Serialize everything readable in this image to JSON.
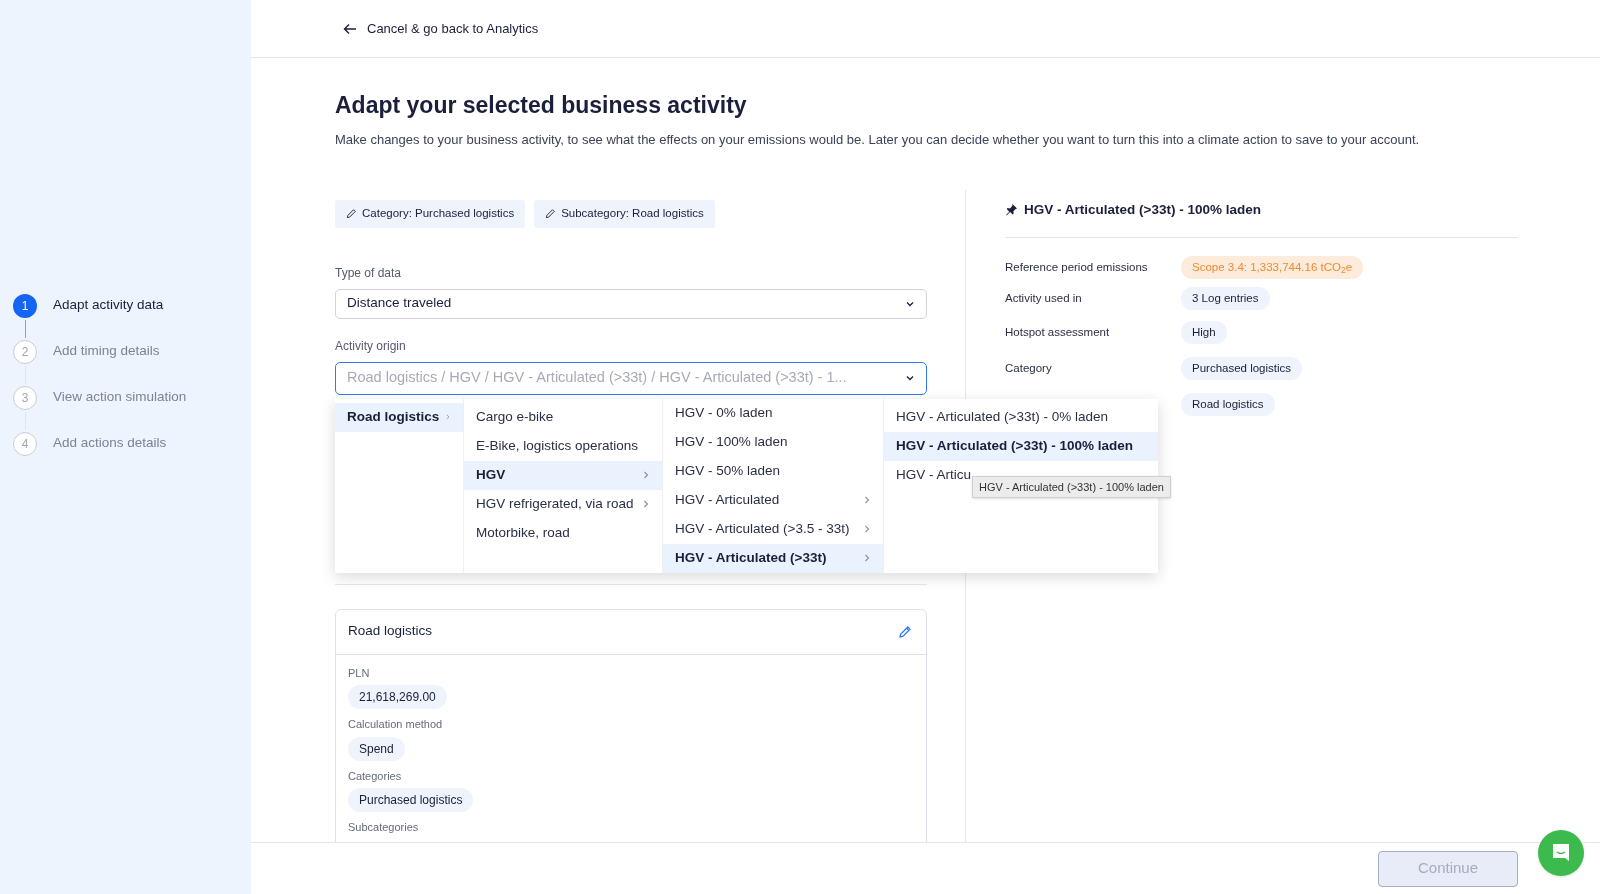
{
  "steps": [
    {
      "number": "1",
      "label": "Adapt activity data",
      "selected": true
    },
    {
      "number": "2",
      "label": "Add timing details",
      "selected": false
    },
    {
      "number": "3",
      "label": "View action simulation",
      "selected": false
    },
    {
      "number": "4",
      "label": "Add actions details",
      "selected": false
    }
  ],
  "back_link": "Cancel & go back to Analytics",
  "title": "Adapt your selected business activity",
  "description": "Make changes to your business activity, to see what the effects on your emissions would be. Later you can decide whether you want to turn this into a climate action to save to your account.",
  "filter_chips": [
    "Category: Purchased logistics",
    "Subcategory: Road logistics"
  ],
  "type_of_data": {
    "label": "Type of data",
    "value": "Distance traveled"
  },
  "activity_origin": {
    "label": "Activity origin",
    "placeholder": "Road logistics / HGV / HGV - Articulated (>33t) / HGV - Articulated (>33t) - 1..."
  },
  "cascade": [
    [
      {
        "label": "Road logistics",
        "has_children": true,
        "selected": true
      }
    ],
    [
      {
        "label": "Cargo e-bike",
        "has_children": false,
        "selected": false
      },
      {
        "label": "E-Bike, logistics operations",
        "has_children": false,
        "selected": false
      },
      {
        "label": "HGV",
        "has_children": true,
        "selected": true
      },
      {
        "label": "HGV refrigerated, via road",
        "has_children": true,
        "selected": false
      },
      {
        "label": "Motorbike, road",
        "has_children": false,
        "selected": false
      }
    ],
    [
      {
        "label": "HGV - 0% laden",
        "has_children": false,
        "selected": false
      },
      {
        "label": "HGV - 100% laden",
        "has_children": false,
        "selected": false
      },
      {
        "label": "HGV - 50% laden",
        "has_children": false,
        "selected": false
      },
      {
        "label": "HGV - Articulated",
        "has_children": true,
        "selected": false
      },
      {
        "label": "HGV - Articulated (>3.5 - 33t)",
        "has_children": true,
        "selected": false
      },
      {
        "label": "HGV - Articulated (>33t)",
        "has_children": true,
        "selected": true
      }
    ],
    [
      {
        "label": "HGV - Articulated (>33t) - 0% laden",
        "has_children": false,
        "selected": false
      },
      {
        "label": "HGV - Articulated (>33t) - 100% laden",
        "has_children": false,
        "selected": true
      },
      {
        "label": "HGV - Articu",
        "has_children": false,
        "selected": false
      }
    ]
  ],
  "tooltip": "HGV - Articulated (>33t) - 100% laden",
  "card": {
    "title": "Road logistics",
    "fields": [
      {
        "label": "PLN",
        "value": "21,618,269.00"
      },
      {
        "label": "Calculation method",
        "value": "Spend"
      },
      {
        "label": "Categories",
        "value": "Purchased logistics"
      },
      {
        "label": "Subcategories"
      }
    ]
  },
  "summary": {
    "title": "HGV - Articulated (>33t) - 100% laden",
    "rows": [
      {
        "label": "Reference period emissions",
        "value": "Scope 3.4: 1,333,744.16 tCO$_{2}$e",
        "kind": "emission"
      },
      {
        "label": "Activity used in",
        "value": "3 Log entries",
        "kind": "plain"
      },
      {
        "label": "Hotspot assessment",
        "value": "High",
        "kind": "plain"
      },
      {
        "label": "Category",
        "value": "Purchased logistics",
        "kind": "plain"
      },
      {
        "value": "Road logistics",
        "kind": "plain"
      }
    ]
  },
  "continue_button": {
    "label": "Continue",
    "disabled": true
  }
}
